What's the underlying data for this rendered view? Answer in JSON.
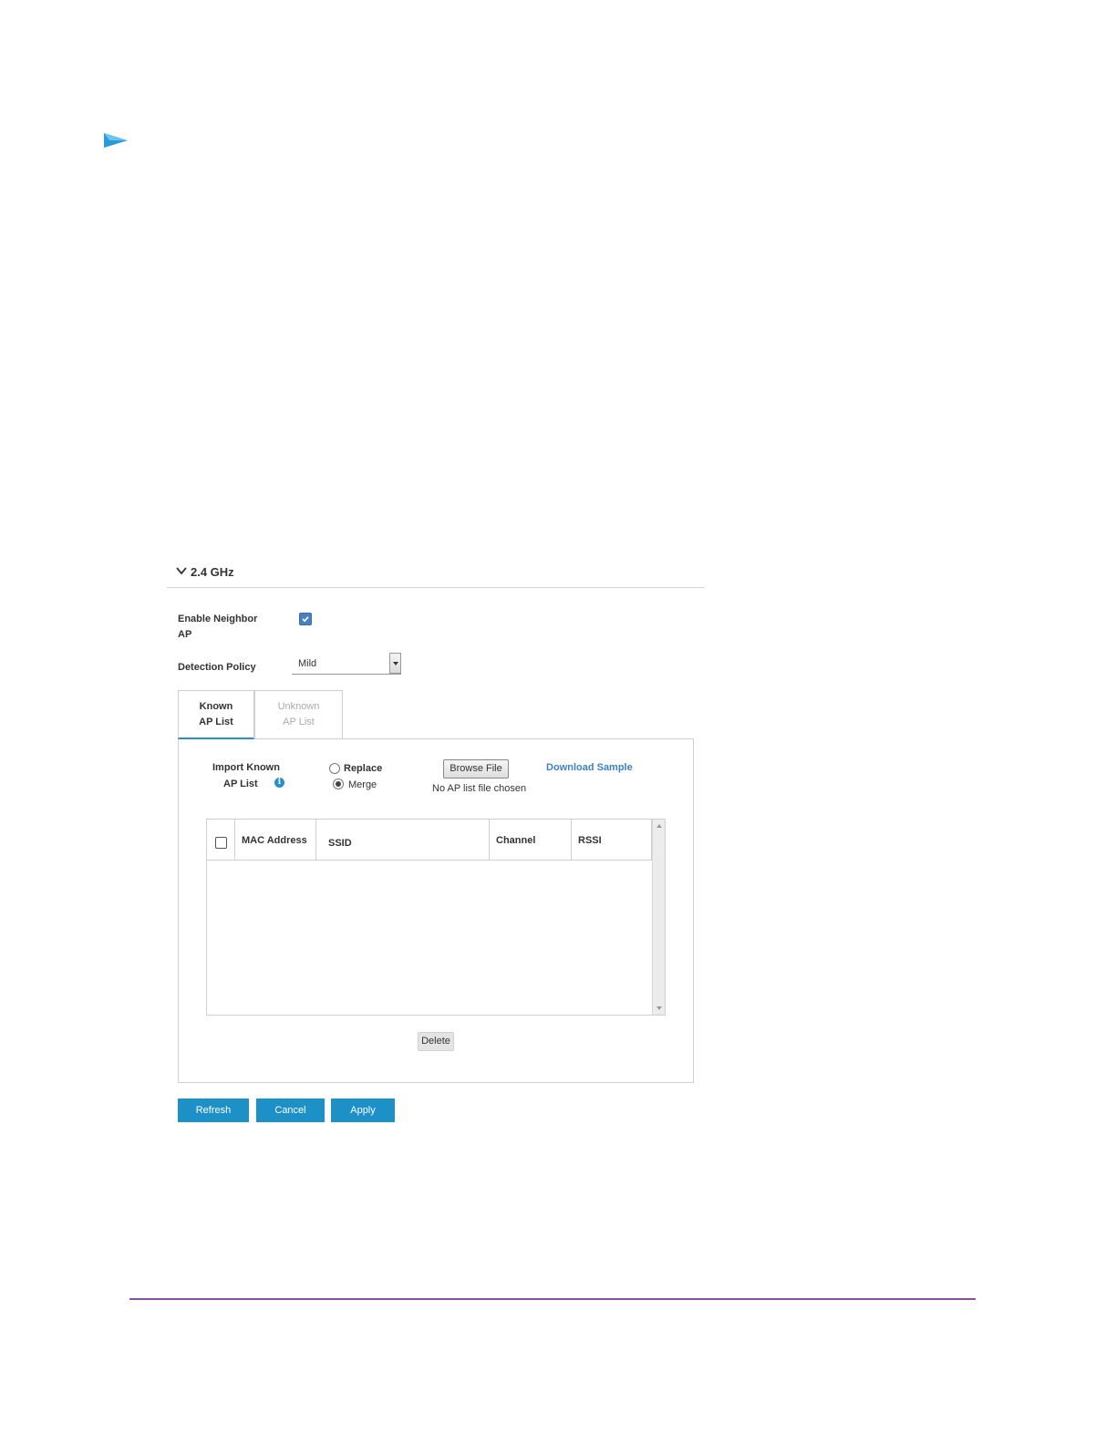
{
  "section": {
    "title": "2.4 GHz"
  },
  "form": {
    "enable_label_line1": "Enable Neighbor",
    "enable_label_line2": "AP",
    "enable_checked": true,
    "detection_label": "Detection Policy",
    "detection_value": "Mild"
  },
  "tabs": [
    {
      "line1": "Known",
      "line2": "AP List",
      "active": true
    },
    {
      "line1": "Unknown",
      "line2": "AP List",
      "active": false
    }
  ],
  "import": {
    "label_line1": "Import Known",
    "label_line2": "AP List",
    "info_glyph": "i",
    "radio_replace": "Replace",
    "radio_merge": "Merge",
    "selected": "Merge",
    "browse_label": "Browse File",
    "file_status": "No AP list file chosen",
    "download_link": "Download Sample"
  },
  "table": {
    "columns": [
      "MAC Address",
      "SSID",
      "Channel",
      "RSSI"
    ],
    "rows": []
  },
  "buttons": {
    "delete": "Delete",
    "refresh": "Refresh",
    "cancel": "Cancel",
    "apply": "Apply"
  },
  "colors": {
    "accent": "#1e90c8",
    "link": "#3d7fc9",
    "checkbox": "#4a7fc1",
    "footer_rule": "#8a4f9e",
    "bullet": "#2a9ad8"
  },
  "icons": {
    "bullet": "triangle-arrow-icon",
    "section_toggle": "chevron-down-icon",
    "info": "info-icon"
  }
}
